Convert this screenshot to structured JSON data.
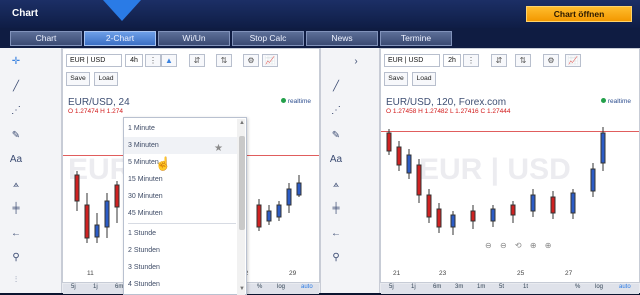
{
  "window": {
    "title": "Chart",
    "open_button": "Chart öffnen"
  },
  "tabs": [
    {
      "label": "Chart",
      "active": false
    },
    {
      "label": "2-Chart",
      "active": true
    },
    {
      "label": "Wi/Un",
      "active": false
    },
    {
      "label": "Stop Calc",
      "active": false
    },
    {
      "label": "News",
      "active": false
    },
    {
      "label": "Termine",
      "active": false
    }
  ],
  "left_chart": {
    "symbol": "EUR | USD",
    "timeframe": "4h",
    "title": "EUR/USD, 24",
    "ohlc": "O 1.27474 H 1.274",
    "realtime": "realtime",
    "watermark": "EUR",
    "x_labels": [
      "11",
      "22",
      "29"
    ],
    "bottom_ranges": [
      "5j",
      "1j",
      "6m",
      "3m",
      "1m",
      "5t",
      "1t",
      "%",
      "log",
      "auto"
    ]
  },
  "right_chart": {
    "symbol": "EUR | USD",
    "timeframe": "2h",
    "title": "EUR/USD, 120, Forex.com",
    "ohlc": "O 1.27458 H 1.27482 L 1.27416 C 1.27444",
    "realtime": "realtime",
    "watermark": "EUR | USD",
    "x_labels": [
      "21",
      "23",
      "25",
      "27"
    ],
    "bottom_ranges": [
      "5j",
      "1j",
      "6m",
      "3m",
      "1m",
      "5t",
      "1t",
      "%",
      "log",
      "auto"
    ]
  },
  "buttons": {
    "save": "Save",
    "load": "Load"
  },
  "dropdown": {
    "items": [
      "1 Minute",
      "3 Minuten",
      "5 Minuten",
      "15 Minuten",
      "30 Minuten",
      "45 Minuten",
      "1 Stunde",
      "2 Stunden",
      "3 Stunden",
      "4 Stunden"
    ],
    "selected": "3 Minuten"
  },
  "colors": {
    "accent": "#2a7be6",
    "bull": "#2c5cc6",
    "bear": "#cf2222",
    "orange": "#f39800"
  }
}
